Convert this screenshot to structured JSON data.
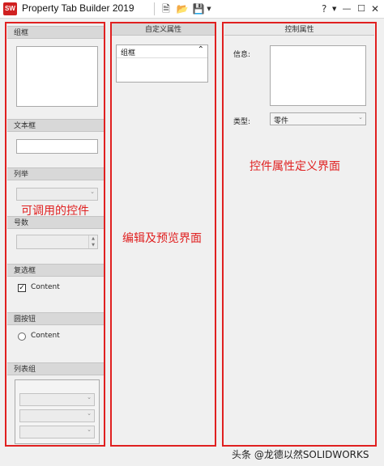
{
  "window": {
    "title": "Property Tab Builder 2019",
    "app_icon_label": "SW",
    "toolbar": {
      "new_icon": "new-file-icon",
      "open_icon": "open-folder-icon",
      "save_icon": "save-disk-icon"
    },
    "help_glyph": "?",
    "minimize_glyph": "—",
    "maximize_glyph": "☐",
    "close_glyph": "✕"
  },
  "left_panel": {
    "sections": {
      "groupbox": "组框",
      "textbox": "文本框",
      "list": "列举",
      "number": "号数",
      "checkbox": "复选框",
      "radio": "圆按钮",
      "listgroup": "列表组"
    },
    "checkbox_label": "Content",
    "radio_label": "Content"
  },
  "middle_panel": {
    "header": "自定义属性",
    "groupbox_label": "组框",
    "collapse_glyph": "⌃"
  },
  "right_panel": {
    "header": "控制属性",
    "info_label": "信息:",
    "type_label": "类型:",
    "type_value": "零件"
  },
  "annotations": {
    "left": "可调用的控件",
    "middle": "编辑及预览界面",
    "right": "控件属性定义界面"
  },
  "watermark": "头条 @龙德以然SOLIDWORKS",
  "colors": {
    "annotation_red": "#e02020",
    "header_gray": "#d8d8d8",
    "background": "#f0f0f0"
  }
}
